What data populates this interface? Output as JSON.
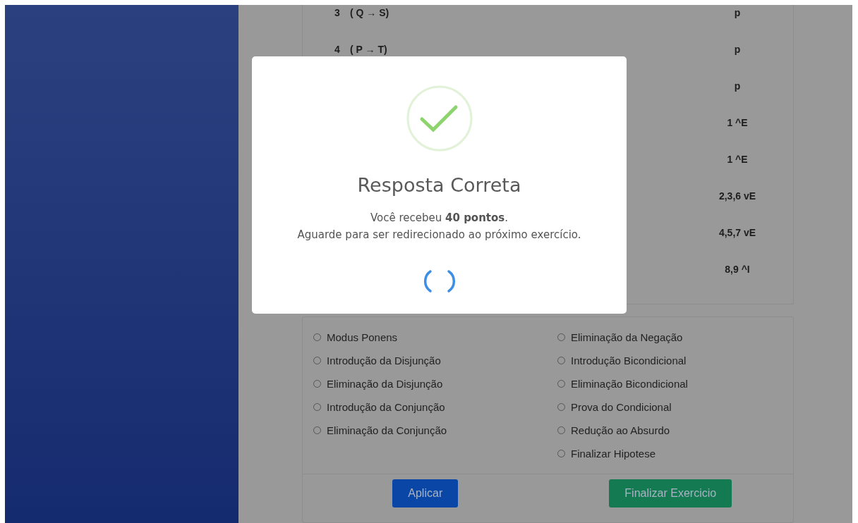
{
  "proof": {
    "rows": [
      {
        "number": "3",
        "formula": "( Q → S)",
        "justification": "p"
      },
      {
        "number": "4",
        "formula": "( P → T)",
        "justification": "p"
      },
      {
        "justification": "p"
      },
      {
        "justification": "1 ^E"
      },
      {
        "justification": "1 ^E"
      },
      {
        "justification": "2,3,6 vE"
      },
      {
        "justification": "4,5,7 vE"
      },
      {
        "justification": "8,9 ^I"
      }
    ]
  },
  "rules": {
    "columns": [
      [
        {
          "label": "Modus Ponens",
          "selected": false
        },
        {
          "label": "Introdução da Disjunção",
          "selected": false
        },
        {
          "label": "Eliminação da Disjunção",
          "selected": false
        },
        {
          "label": "Introdução da Conjunção",
          "selected": false
        },
        {
          "label": "Eliminação da Conjunção",
          "selected": false
        }
      ],
      [
        {
          "label": "Eliminação da Negação",
          "selected": false
        },
        {
          "label": "Introdução Bicondicional",
          "selected": false
        },
        {
          "label": "Eliminação Bicondicional",
          "selected": false
        },
        {
          "label": "Prova do Condicional",
          "selected": false
        },
        {
          "label": "Redução ao Absurdo",
          "selected": false
        },
        {
          "label": "Finalizar Hipotese",
          "selected": false
        }
      ]
    ],
    "buttons": [
      {
        "label": "Aplicar",
        "kind": "primary"
      },
      {
        "label": "Finalizar Exercicio",
        "kind": "success"
      }
    ]
  },
  "modal": {
    "title": "Resposta Correta",
    "message": "Você recebeu **40 pontos**.",
    "note": "Aguarde para ser redirecionado ao próximo exercício."
  }
}
